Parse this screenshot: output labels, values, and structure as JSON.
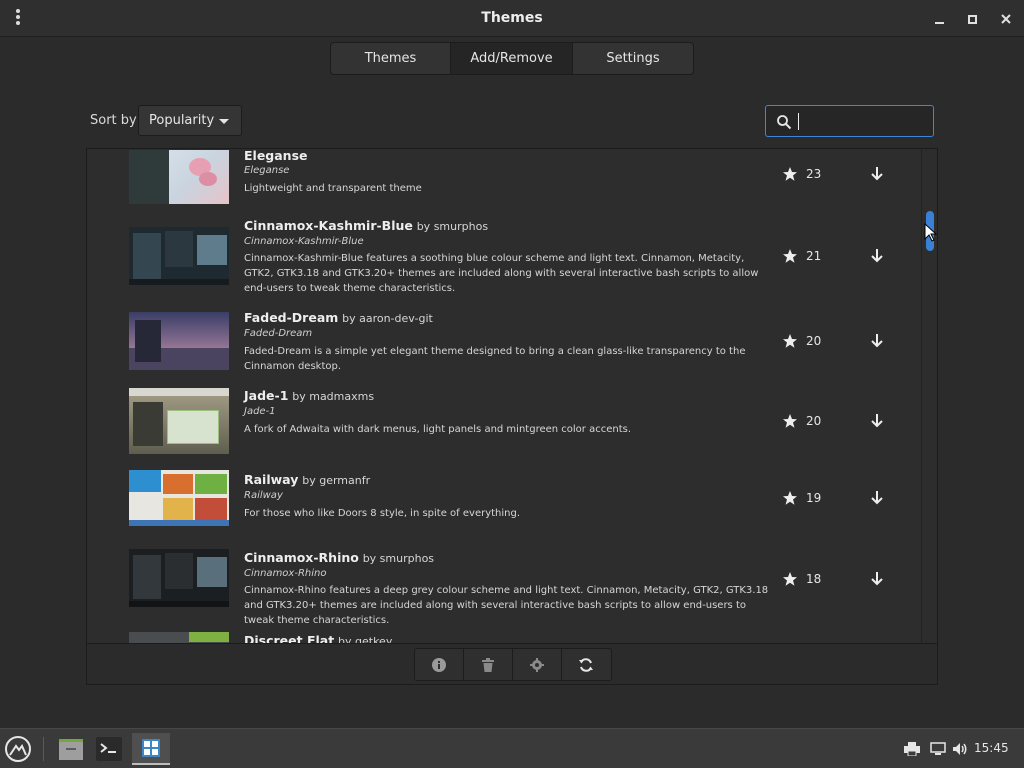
{
  "window": {
    "title": "Themes",
    "controls": [
      "minimize",
      "maximize",
      "close"
    ]
  },
  "tabs": [
    {
      "label": "Themes"
    },
    {
      "label": "Add/Remove",
      "active": true
    },
    {
      "label": "Settings"
    }
  ],
  "sort": {
    "label": "Sort by",
    "selected": "Popularity"
  },
  "search": {
    "value": "",
    "icon": "search-icon"
  },
  "themes": [
    {
      "name": "Eleganse",
      "author": "",
      "uuid": "Eleganse",
      "description": "Lightweight and transparent theme",
      "score": "23"
    },
    {
      "name": "Cinnamox-Kashmir-Blue",
      "author": "by smurphos",
      "uuid": "Cinnamox-Kashmir-Blue",
      "description": "Cinnamox-Kashmir-Blue features a soothing blue colour scheme and light text. Cinnamon, Metacity, GTK2, GTK3.18 and GTK3.20+ themes are included along with several interactive bash scripts to allow end-users to tweak theme characteristics.",
      "score": "21"
    },
    {
      "name": "Faded-Dream",
      "author": "by aaron-dev-git",
      "uuid": "Faded-Dream",
      "description": "Faded-Dream is a simple yet elegant theme designed to bring a clean glass-like transparency to the Cinnamon desktop.",
      "score": "20"
    },
    {
      "name": "Jade-1",
      "author": "by madmaxms",
      "uuid": "Jade-1",
      "description": "A fork of Adwaita with dark menus, light panels and mintgreen color accents.",
      "score": "20"
    },
    {
      "name": "Railway",
      "author": "by germanfr",
      "uuid": "Railway",
      "description": "For those who like Doors 8 style, in spite of everything.",
      "score": "19"
    },
    {
      "name": "Cinnamox-Rhino",
      "author": "by smurphos",
      "uuid": "Cinnamox-Rhino",
      "description": "Cinnamox-Rhino features a deep grey colour scheme and light text. Cinnamon, Metacity, GTK2, GTK3.18 and GTK3.20+ themes are included along with several interactive bash scripts to allow end-users to tweak theme characteristics.",
      "score": "18"
    },
    {
      "name": "Discreet Flat",
      "author": "by getkey",
      "uuid": "",
      "description": "",
      "score": ""
    }
  ],
  "actions": [
    "info-icon",
    "trash-icon",
    "gear-icon",
    "refresh-icon"
  ],
  "taskbar": {
    "clock": "15:45",
    "apps": [
      "menu",
      "files",
      "terminal",
      "themes"
    ],
    "tray": [
      "printer-icon",
      "network-icon",
      "volume-icon"
    ]
  },
  "colors": {
    "accent": "#3a80d5",
    "window_bg": "#2b2b2b",
    "panel_bg": "#3a3a3a"
  }
}
